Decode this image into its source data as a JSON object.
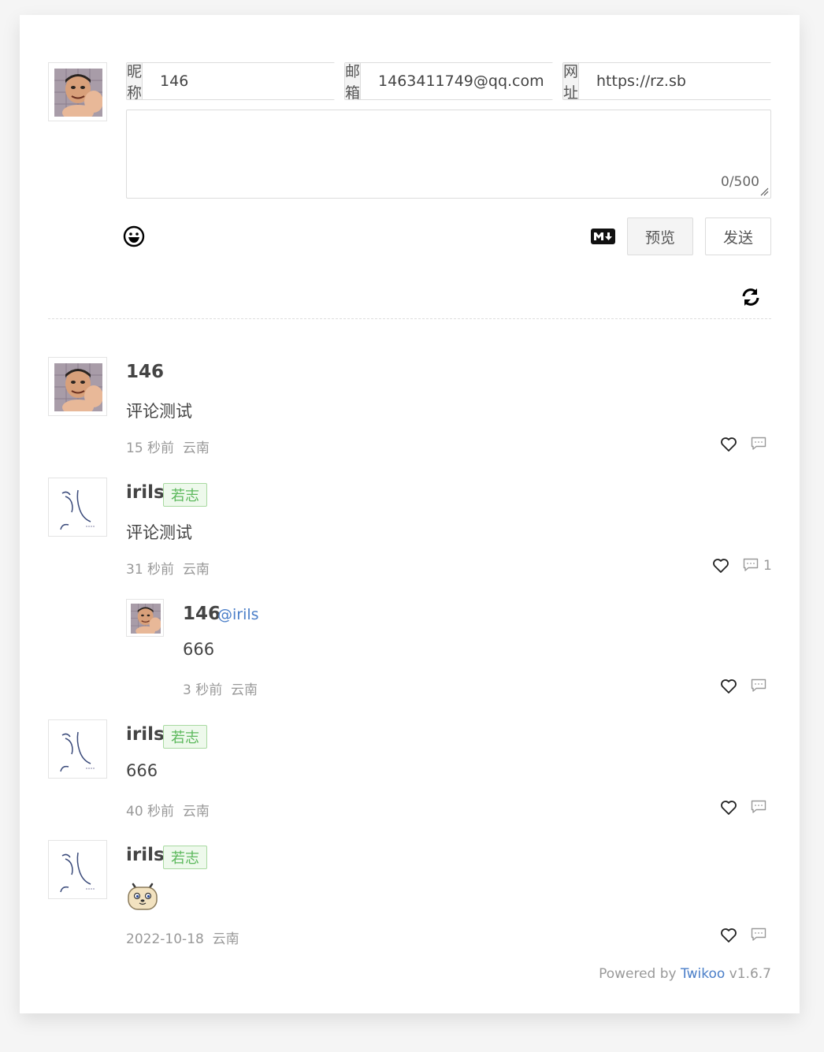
{
  "form": {
    "nick": {
      "label": "昵称",
      "value": "146"
    },
    "mail": {
      "label": "邮箱",
      "value": "1463411749@qq.com"
    },
    "link": {
      "label": "网址",
      "value": "https://rz.sb"
    },
    "counter": "0/500",
    "preview_label": "预览",
    "send_label": "发送",
    "emoji_icon": "emoji-smile-icon",
    "markdown_icon": "markdown-icon",
    "refresh_icon": "refresh-icon"
  },
  "comments": [
    {
      "nick": "146",
      "badge": "",
      "content": "评论测试",
      "time": "15 秒前",
      "location": "云南",
      "replies": "",
      "avatar": "meme-face"
    },
    {
      "nick": "irils",
      "badge": "若志",
      "content": "评论测试",
      "time": "31 秒前",
      "location": "云南",
      "replies": "1",
      "avatar": "sketch",
      "reply": {
        "nick": "146",
        "mention": "@irils",
        "content": "666",
        "time": "3 秒前",
        "location": "云南"
      }
    },
    {
      "nick": "irils",
      "badge": "若志",
      "content": "666",
      "time": "40 秒前",
      "location": "云南",
      "replies": "",
      "avatar": "sketch"
    },
    {
      "nick": "irils",
      "badge": "若志",
      "content": "",
      "time": "2022-10-18",
      "location": "云南",
      "replies": "",
      "avatar": "sketch",
      "sticker": "doge-sticker-icon"
    }
  ],
  "footer": {
    "powered": "Powered by ",
    "link": "Twikoo",
    "version": " v1.6.7"
  },
  "colors": {
    "accent": "#4a7ec8",
    "badge_green": "#5cb85c"
  }
}
